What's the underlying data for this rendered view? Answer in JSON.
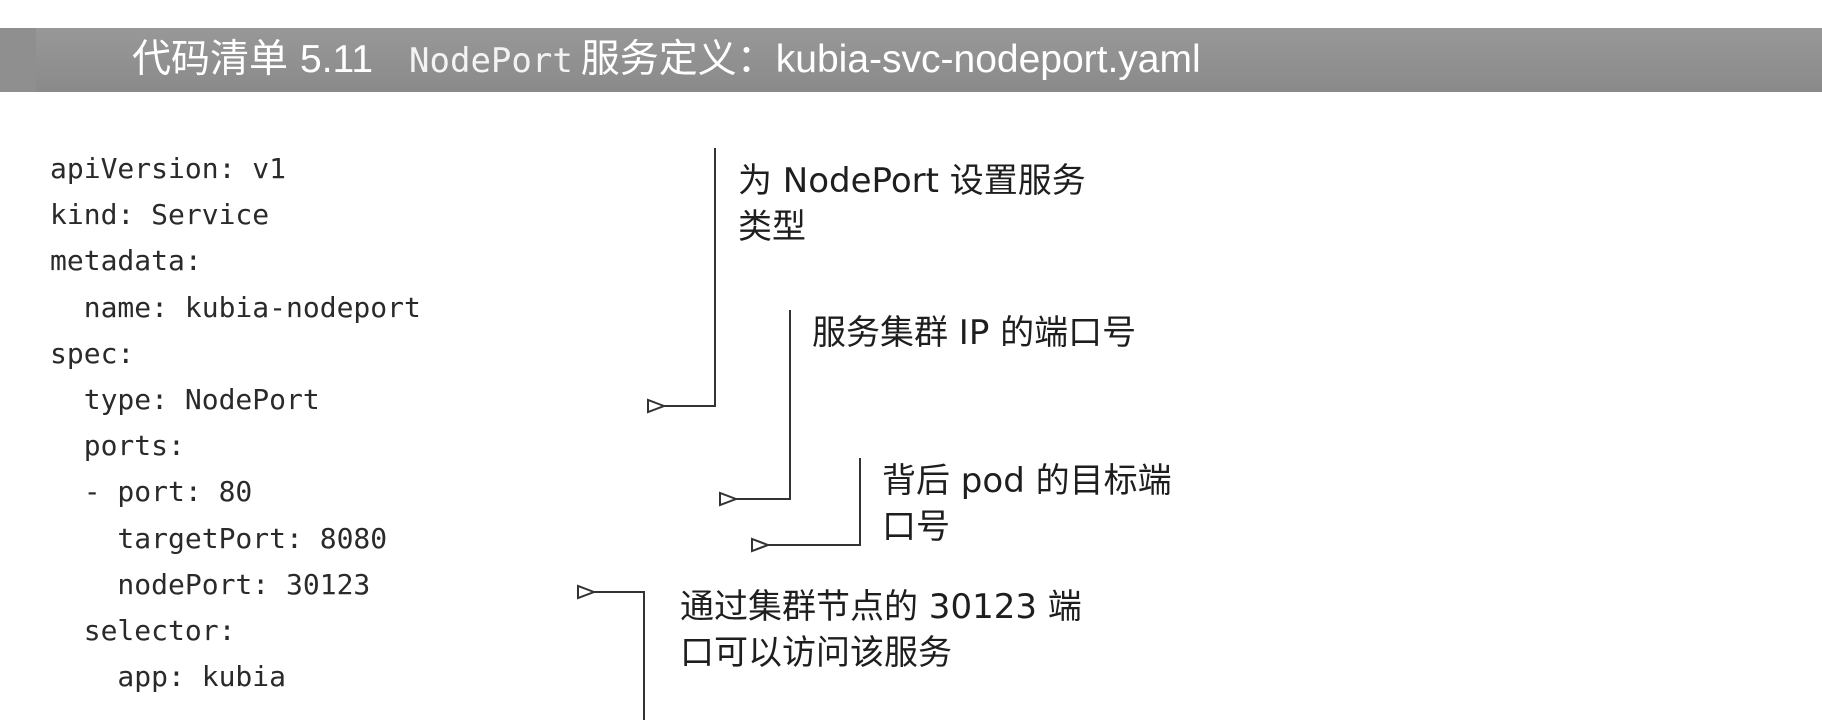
{
  "title": {
    "label": "代码清单",
    "number": "5.11",
    "keyword": "NodePort",
    "rest": "服务定义：kubia-svc-nodeport.yaml"
  },
  "code_lines": [
    "apiVersion: v1",
    "kind: Service",
    "metadata:",
    "  name: kubia-nodeport",
    "spec:",
    "  type: NodePort",
    "  ports:",
    "  - port: 80",
    "    targetPort: 8080",
    "    nodePort: 30123",
    "  selector:",
    "    app: kubia"
  ],
  "annotations": [
    {
      "line1": "为 NodePort 设置服务",
      "line2": "类型"
    },
    {
      "line1": "服务集群 IP 的端口号"
    },
    {
      "line1": "背后 pod 的目标端",
      "line2": "口号"
    },
    {
      "line1": "通过集群节点的 30123 端",
      "line2": "口可以访问该服务"
    }
  ],
  "colors": {
    "title_bar": "#8f8f8f",
    "title_text": "#ffffff",
    "code_text": "#2a2a2a",
    "callout_line": "#333333"
  }
}
